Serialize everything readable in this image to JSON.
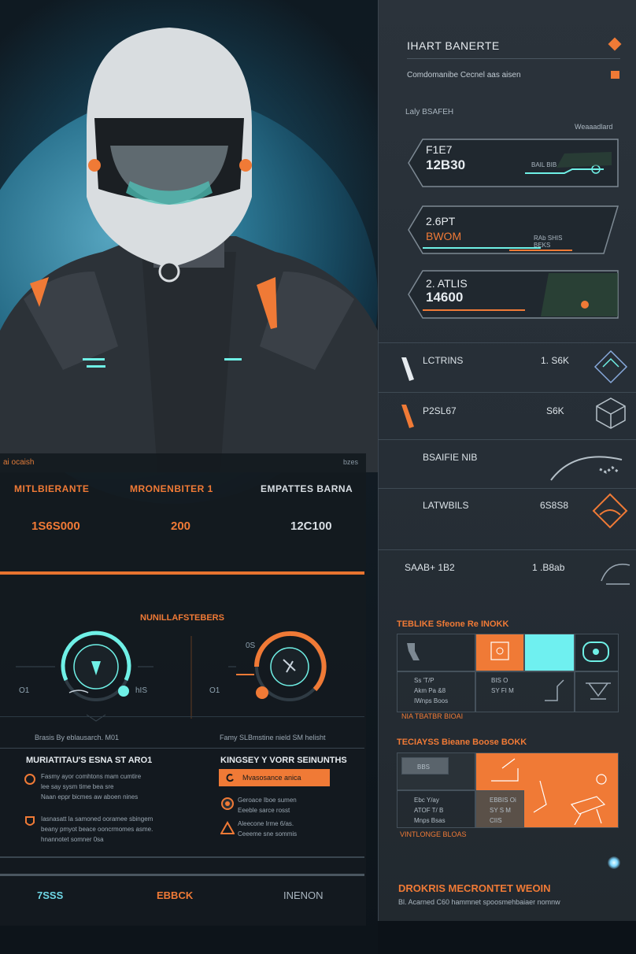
{
  "hero": {
    "stats_tag_left": "ai ocaish",
    "stats_tag_right": "bzes",
    "columns": [
      {
        "label": "MITLBIERANTE",
        "value": "1S6S000"
      },
      {
        "label": "MRONENBITER 1",
        "value": "200"
      },
      {
        "label": "EMPATTES BARNA",
        "value": "12C100"
      }
    ],
    "section_title": "NUNILLAFSTEBERS",
    "gauges": {
      "left_label": "O1",
      "left_right_label": "hIS",
      "right_label": "O1",
      "right_top_label": "0S"
    },
    "captions": {
      "left": "Brasis By eblausarch. M01",
      "right": "Famy SLBmstine nield SM helisht"
    },
    "left_column": {
      "title": "MURIATITAU'S ESNA ST ARO1",
      "items": [
        "Fasmy ayor comhtons mam cumtire\nlee say sysm time bea sre\nNaan eppr bicmes aw aboen nines",
        "Iasnasatt la samoned ooramee sbingem\nbeany pmyot beace ooncrmomes asme.\nhnannotet somner 0sa"
      ]
    },
    "right_column": {
      "title": "KINGSEY Y VORR SEINUNTHS",
      "pill": "Mvasosance anica",
      "items": [
        "Geroace Iboe sumen\nEeeble sarce rosst",
        "Aleecone Irme 6/as.\nCeeeme sne sommis"
      ]
    },
    "bottom_bar": [
      "7SSS",
      "EBBCK",
      "INENON"
    ]
  },
  "panel": {
    "title": "IHART BANERTE",
    "subtitle": "Comdomanibe Cecnel aas aisen",
    "section": "Laly BSAFEH",
    "section_right": "Weaaadlard",
    "cards": [
      {
        "l1": "F1E7",
        "l2": "12B30",
        "mid": "BAIL BIB"
      },
      {
        "l1": "2.6PT",
        "l2": "BWOM",
        "mid": "RAb SHIS\nBEKS"
      },
      {
        "l1": "2. ATLIS",
        "l2": "14600",
        "mid": ""
      }
    ],
    "rows": [
      {
        "left": "LCTRINS",
        "right": "1. S6K"
      },
      {
        "left": "P2SL67",
        "right": "S6K"
      },
      {
        "left": "BSAIFIE NIB",
        "right": ""
      },
      {
        "left": "LATWBILS",
        "right": "6S8S8"
      },
      {
        "left": "SAAB+ 1B2",
        "right": "1 .B8ab"
      }
    ],
    "grid1": {
      "title": "TEBLIKE Sfeone Re INOKK",
      "texts": [
        "Ss 'T/P\nAkm Pa &8\nIWnps Boos",
        "BIS O\nSY FI M"
      ],
      "footer": "NIA TBATBR BIOAI"
    },
    "grid2": {
      "title": "TECIAYSS Bieane Boose BOKK",
      "cell_label": "BBS",
      "texts": [
        "Ebc Y/ay\nATOF T/ B\nMnps Bsas",
        "EBBIS Oi\nSY S M\nCIIS"
      ],
      "footer": "VINTLONGE BLOAS"
    },
    "footer_title": "DROKRIS MECRONTET WEOIN",
    "footer_subtitle": "Bl. Acarned C60 hammnet spoosmehbaiaer nomnw"
  },
  "colors": {
    "accent_orange": "#f07a36",
    "accent_teal": "#6ff0e6",
    "panel_bg": "#2b333b"
  }
}
